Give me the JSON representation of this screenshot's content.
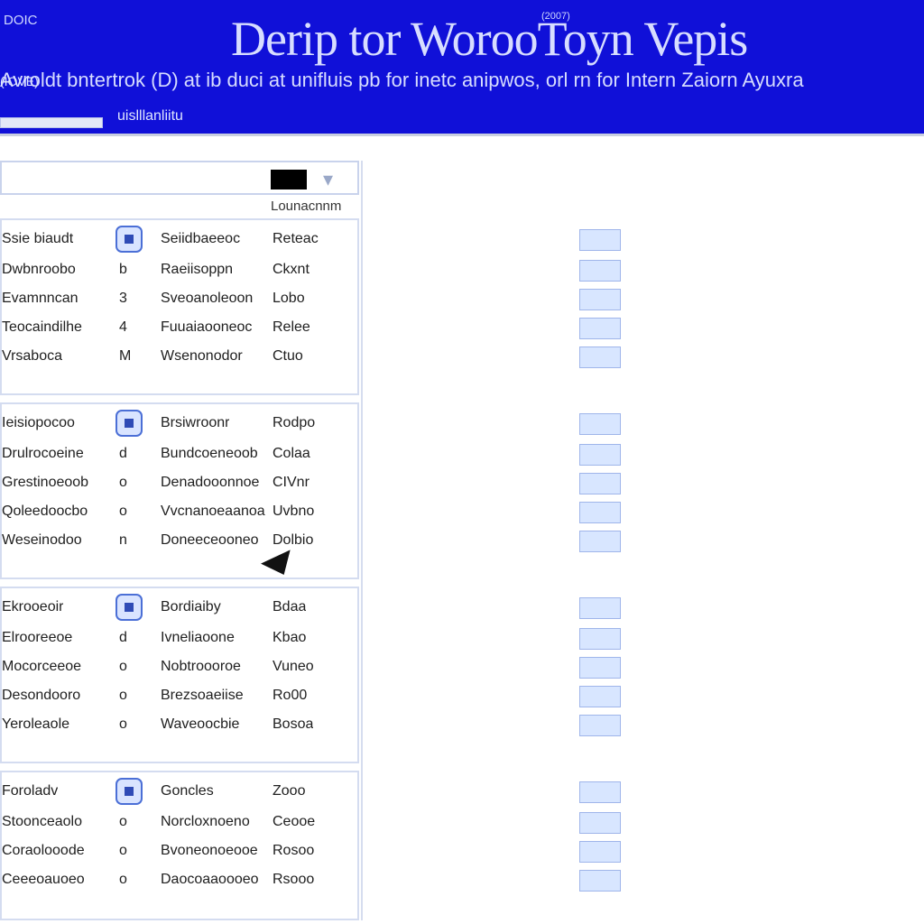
{
  "window": {
    "title": "Derip tor WorooToyn Vepis",
    "corner_text": "DOIC",
    "tiny_top": "(2007)",
    "subtitle": "Avroldt bntertrok (D) at ib duci at unifluis pb for inetc anipwos, orl rn for Intern Zaiorn Ayuxra",
    "sub_left": "(IOVE)",
    "crumb": "uislllanliitu"
  },
  "search": {
    "placeholder": "",
    "value": "",
    "side_label": "Lounacnnm"
  },
  "groups": [
    {
      "rows": [
        {
          "left": "Ssie biaudt",
          "num": "",
          "main": "Seiidbaeeoc",
          "right": "Reteac"
        },
        {
          "left": "Dwbnroobo",
          "num": "b",
          "main": "Raeiisoppn",
          "right": "Ckxnt"
        },
        {
          "left": "Evamnncan",
          "num": "3",
          "main": "Sveoanoleoon",
          "right": "Lobo"
        },
        {
          "left": "Teocaindilhe",
          "num": "4",
          "main": "Fuuaiaooneoc",
          "right": "Relee"
        },
        {
          "left": "Vrsaboca",
          "num": "M",
          "main": "Wsenonodor",
          "right": "Ctuo"
        }
      ]
    },
    {
      "rows": [
        {
          "left": "Ieisiopocoo",
          "num": "",
          "main": "Brsiwroonr",
          "right": "Rodpo"
        },
        {
          "left": "Drulrocoeine",
          "num": "d",
          "main": "Bundcoeneoob",
          "right": "Colaa"
        },
        {
          "left": "Grestinoeoob",
          "num": "o",
          "main": "Denadooonnoe",
          "right": "CIVnr"
        },
        {
          "left": "Qoleedoocbo",
          "num": "o",
          "main": "Vvcnanoeaanoa",
          "right": "Uvbno"
        },
        {
          "left": "Weseinodoo",
          "num": "n",
          "main": "Doneeceooneo",
          "right": "Dolbio"
        }
      ]
    },
    {
      "rows": [
        {
          "left": "Ekrooeoir",
          "num": "",
          "main": "Bordiaiby",
          "right": "Bdaa"
        },
        {
          "left": "Elrooreeoe",
          "num": "d",
          "main": "Ivneliaoone",
          "right": "Kbao"
        },
        {
          "left": "Mocorceeoe",
          "num": "o",
          "main": "Nobtroooroe",
          "right": "Vuneo"
        },
        {
          "left": "Desondooro",
          "num": "o",
          "main": "Brezsoaeiise",
          "right": "Ro00"
        },
        {
          "left": "Yeroleaole",
          "num": "o",
          "main": "Waveoocbie",
          "right": "Bosoa"
        }
      ]
    },
    {
      "rows": [
        {
          "left": "Foroladv",
          "num": "",
          "main": "Goncles",
          "right": "Zooo"
        },
        {
          "left": "Stoonceaolo",
          "num": "o",
          "main": "Norcloxnoeno",
          "right": "Ceooe"
        },
        {
          "left": "Coraolooode",
          "num": "o",
          "main": "Bvoneonoeooe",
          "right": "Rosoo"
        },
        {
          "left": "Ceeeoauoeo",
          "num": "o",
          "main": "Daocoaaoooeo",
          "right": "Rsooo"
        }
      ]
    }
  ]
}
